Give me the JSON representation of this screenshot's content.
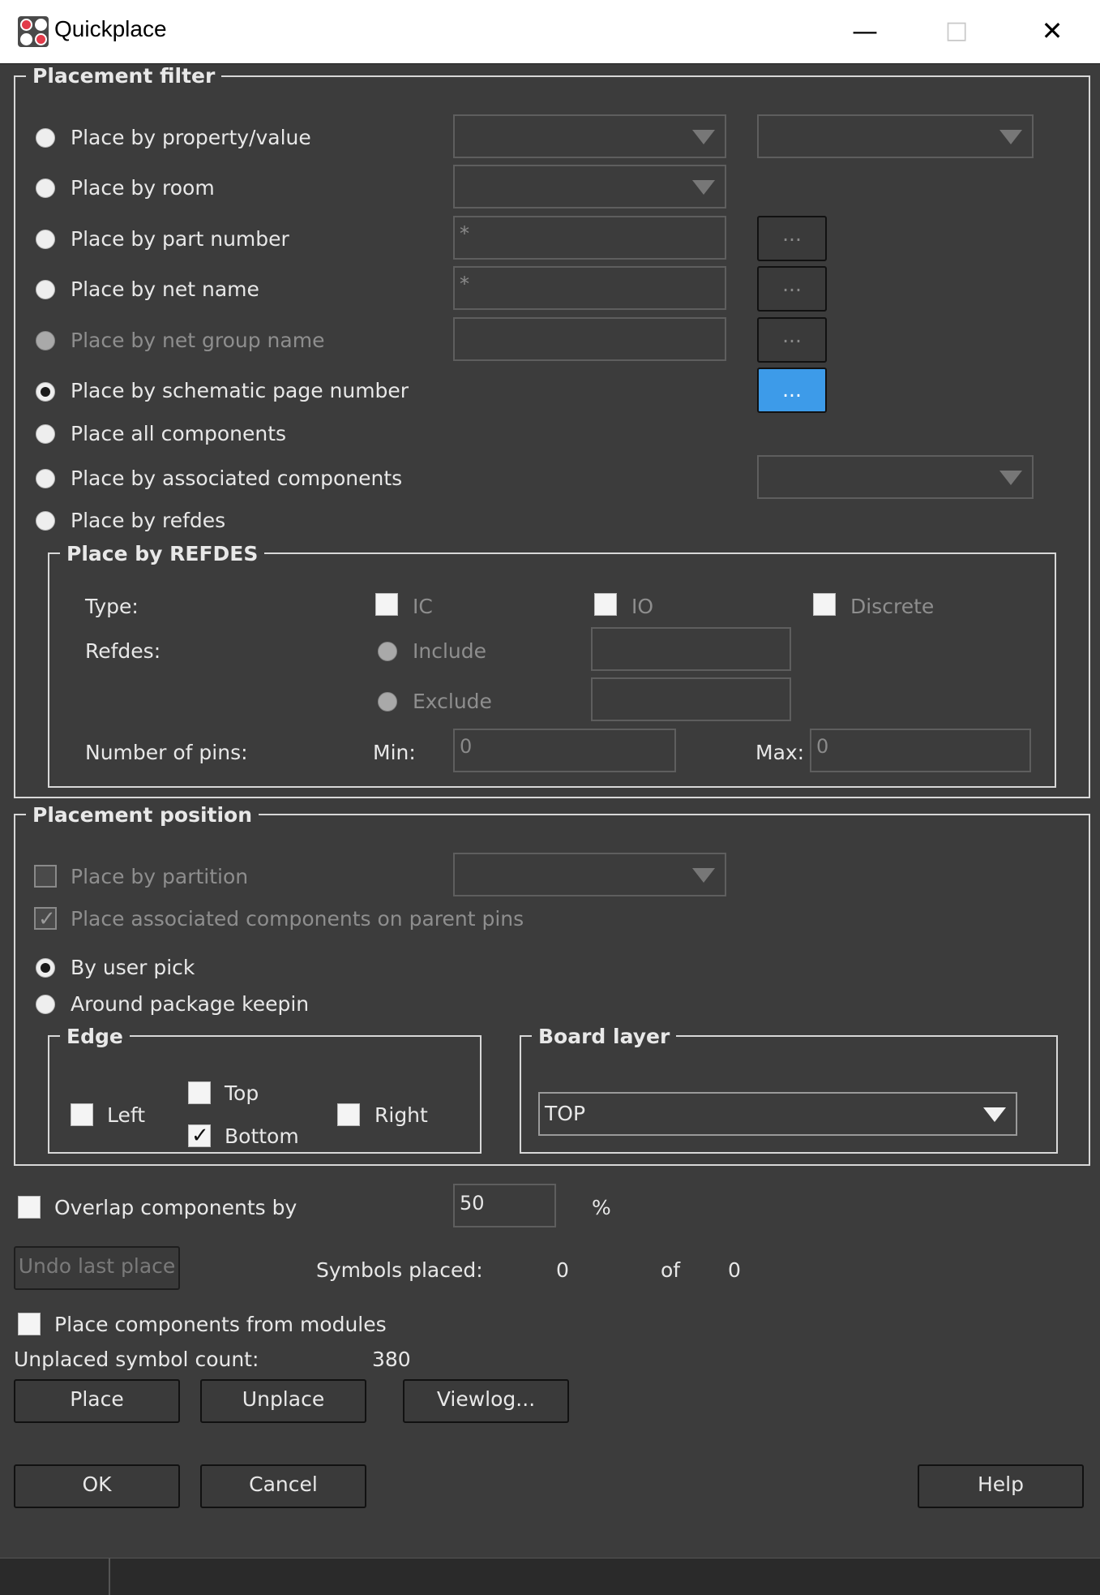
{
  "window": {
    "title": "Quickplace",
    "minimize": "—",
    "maximize": "□",
    "close": "✕",
    "icon": "app-icon"
  },
  "placement_filter": {
    "legend": "Placement filter",
    "options": [
      "Place by property/value",
      "Place by room",
      "Place by part number",
      "Place by net name",
      "Place by net group name",
      "Place by schematic page number",
      "Place all components",
      "Place by associated components",
      "Place by refdes"
    ],
    "selected": "Place by schematic page number",
    "part_number_value": "*",
    "net_name_value": "*",
    "browse_label": "...",
    "refdes_group": {
      "legend": "Place by REFDES",
      "type_label": "Type:",
      "type_ic": "IC",
      "type_io": "IO",
      "type_discrete": "Discrete",
      "refdes_label": "Refdes:",
      "include": "Include",
      "exclude": "Exclude",
      "pins_label": "Number of pins:",
      "min_label": "Min:",
      "min_value": "0",
      "max_label": "Max:",
      "max_value": "0"
    }
  },
  "placement_position": {
    "legend": "Placement position",
    "by_partition": "Place by partition",
    "assoc_parent_pins": "Place associated components on parent pins",
    "by_user_pick": "By user pick",
    "around_keepin": "Around package keepin",
    "edge": {
      "legend": "Edge",
      "left": "Left",
      "top": "Top",
      "bottom": "Bottom",
      "right": "Right"
    },
    "board_layer": {
      "legend": "Board layer",
      "value": "TOP"
    }
  },
  "overlap": {
    "label": "Overlap components by",
    "value": "50",
    "unit": "%"
  },
  "undo_label": "Undo last place",
  "symbols_placed": {
    "label": "Symbols placed:",
    "placed": "0",
    "of_label": "of",
    "total": "0"
  },
  "modules_label": "Place components from modules",
  "unplaced": {
    "label": "Unplaced symbol count:",
    "value": "380"
  },
  "buttons": {
    "place": "Place",
    "unplace": "Unplace",
    "viewlog": "Viewlog...",
    "ok": "OK",
    "cancel": "Cancel",
    "help": "Help"
  },
  "colors": {
    "background": "#3c3c3c",
    "accent": "#3d9be9",
    "text": "#e8e8e8",
    "disabled_text": "#8e8e8e"
  }
}
